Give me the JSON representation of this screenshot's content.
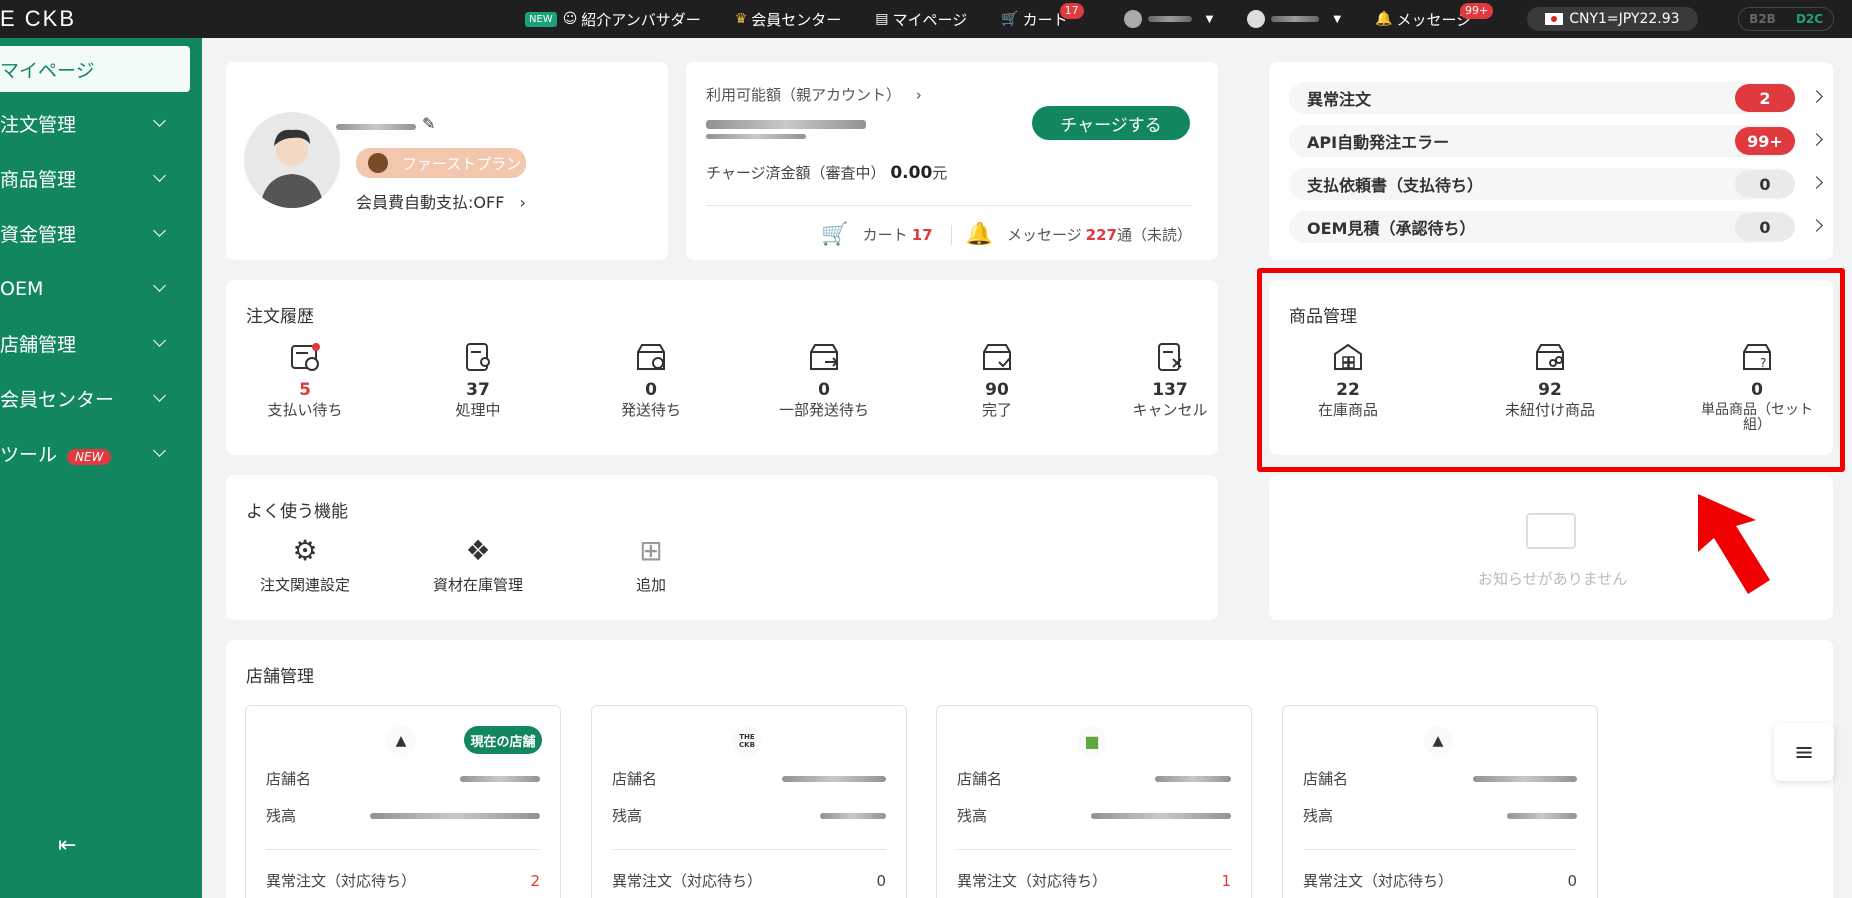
{
  "topbar": {
    "logo": "E CKB",
    "new_badge": "NEW",
    "ambassador": "紹介アンバサダー",
    "member_center": "会員センター",
    "mypage": "マイページ",
    "cart": "カート",
    "cart_count": "17",
    "message": "メッセージ",
    "message_count": "99+",
    "currency": "CNY1=JPY22.93",
    "mode_b2b": "B2B",
    "mode_d2c": "D2C"
  },
  "sidebar": {
    "items": [
      {
        "label": "マイページ"
      },
      {
        "label": "注文管理"
      },
      {
        "label": "商品管理"
      },
      {
        "label": "資金管理"
      },
      {
        "label": "OEM"
      },
      {
        "label": "店舗管理"
      },
      {
        "label": "会員センター"
      },
      {
        "label": "ツール"
      }
    ],
    "tool_new": "NEW"
  },
  "profile": {
    "plan": "ファーストプラン",
    "autopay": "会員費自動支払:OFF"
  },
  "balance": {
    "label": "利用可能額（親アカウント）",
    "charge_button": "チャージする",
    "pending_label": "チャージ済金額（審査中）",
    "pending_value": "0.00",
    "pending_unit": "元",
    "cart_label": "カート",
    "cart_count": "17",
    "message_label": "メッセージ",
    "message_count": "227",
    "message_suffix": "通（未読）"
  },
  "alerts": [
    {
      "label": "異常注文",
      "count": "2",
      "color": "red"
    },
    {
      "label": "API自動発注エラー",
      "count": "99+",
      "color": "red"
    },
    {
      "label": "支払依頼書（支払待ち）",
      "count": "0",
      "color": "grey"
    },
    {
      "label": "OEM見積（承認待ち）",
      "count": "0",
      "color": "grey"
    }
  ],
  "orders": {
    "title": "注文履歴",
    "stats": [
      {
        "num": "5",
        "label": "支払い待ち",
        "icon": "wallet-clock-icon"
      },
      {
        "num": "37",
        "label": "処理中",
        "icon": "doc-person-icon"
      },
      {
        "num": "0",
        "label": "発送待ち",
        "icon": "box-clock-icon"
      },
      {
        "num": "0",
        "label": "一部発送待ち",
        "icon": "box-arrow-icon"
      },
      {
        "num": "90",
        "label": "完了",
        "icon": "box-check-icon"
      },
      {
        "num": "137",
        "label": "キャンセル",
        "icon": "doc-x-icon"
      }
    ]
  },
  "products": {
    "title": "商品管理",
    "stats": [
      {
        "num": "22",
        "label": "在庫商品"
      },
      {
        "num": "92",
        "label": "未紐付け商品"
      },
      {
        "num": "0",
        "label": "単品商品（セット組）"
      }
    ]
  },
  "features": {
    "title": "よく使う機能",
    "items": [
      {
        "label": "注文関連設定",
        "icon": "gear-icon"
      },
      {
        "label": "資材在庫管理",
        "icon": "materials-icon"
      },
      {
        "label": "追加",
        "icon": "plus-icon"
      }
    ]
  },
  "notice": {
    "empty": "お知らせがありません"
  },
  "stores": {
    "title": "店舗管理",
    "current_badge": "現在の店舗",
    "name_label": "店舗名",
    "balance_label": "残高",
    "abnormal_label": "異常注文（対応待ち）",
    "cards": [
      {
        "abnormal": "2",
        "logo": "tent-icon",
        "current": true
      },
      {
        "abnormal": "0",
        "logo": "theckb-logo",
        "logo_text": "THE CKB",
        "current": false
      },
      {
        "abnormal": "1",
        "logo": "shopify-icon",
        "current": false
      },
      {
        "abnormal": "0",
        "logo": "tent-icon",
        "current": false
      }
    ]
  },
  "colors": {
    "brand": "#12875f",
    "red": "#e0393e",
    "highlight": "#f00000"
  }
}
